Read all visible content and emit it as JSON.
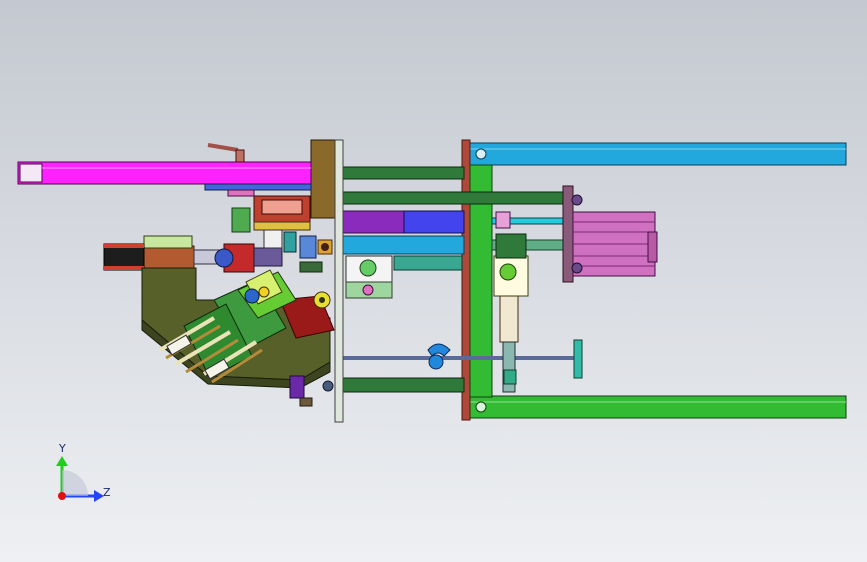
{
  "viewport": {
    "background_top": "#c4c8d0",
    "background_bottom": "#eef0f3"
  },
  "triad": {
    "y_label": "Y",
    "z_label": "Z",
    "y_axis_color": "#22cc22",
    "z_axis_color": "#2244ff",
    "origin_color": "#dd1111"
  },
  "model_colors": {
    "magenta_beam": "#ff22ff",
    "cyan_beam": "#22a8dd",
    "green_beam": "#33bb33",
    "rust_plate": "#b0483a",
    "olive_body": "#58602a",
    "motor": "#d070c0",
    "purple_rod": "#8a2bbe",
    "blue_rod": "#4444ee",
    "dark_green_rod": "#2f7a3a",
    "gold_block": "#8a6a2a"
  }
}
